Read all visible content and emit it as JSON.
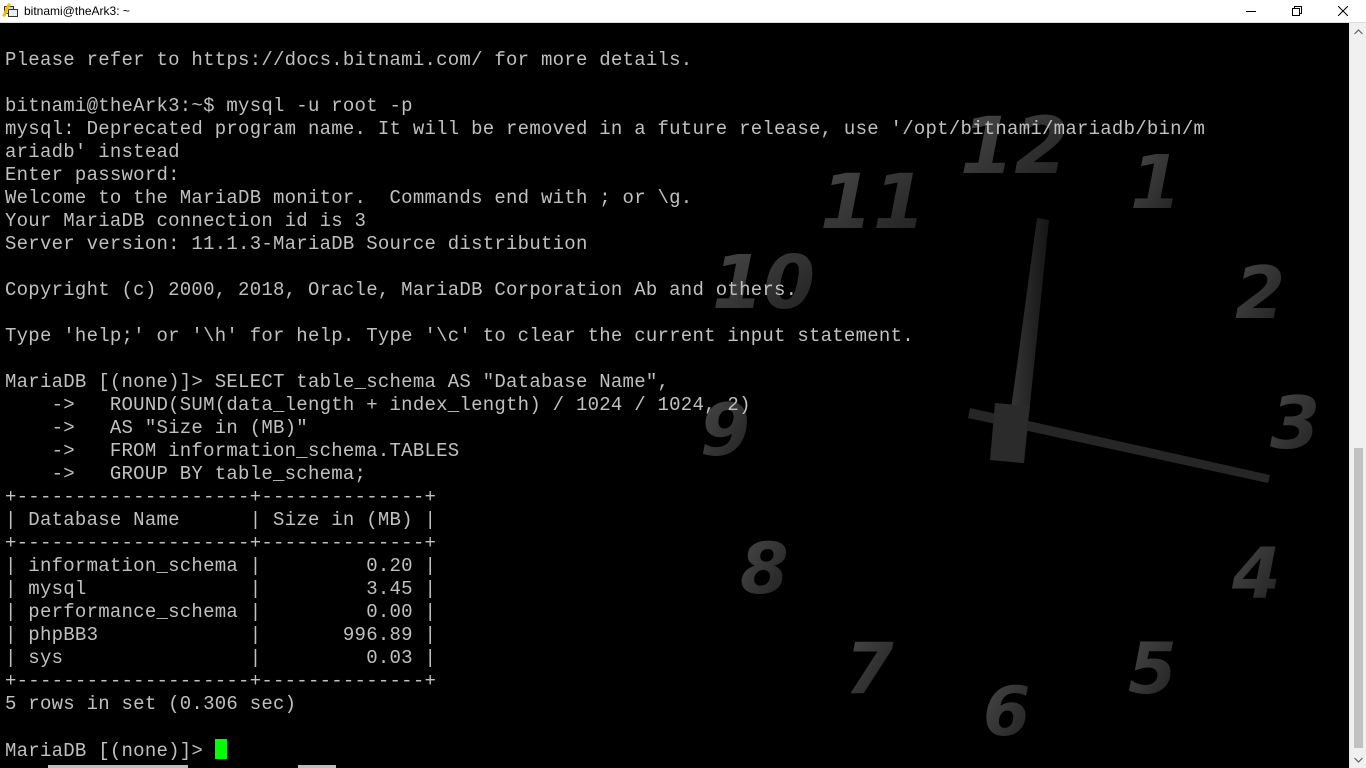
{
  "window": {
    "title": "bitnami@theArk3: ~",
    "app_icon": "putty-icon",
    "minimize_icon": "minimize-icon",
    "restore_icon": "restore-icon",
    "close_icon": "close-icon"
  },
  "terminal": {
    "lines": [
      "Please refer to https://docs.bitnami.com/ for more details.",
      "",
      "bitnami@theArk3:~$ mysql -u root -p",
      "mysql: Deprecated program name. It will be removed in a future release, use '/opt/bitnami/mariadb/bin/m",
      "ariadb' instead",
      "Enter password:",
      "Welcome to the MariaDB monitor.  Commands end with ; or \\g.",
      "Your MariaDB connection id is 3",
      "Server version: 11.1.3-MariaDB Source distribution",
      "",
      "Copyright (c) 2000, 2018, Oracle, MariaDB Corporation Ab and others.",
      "",
      "Type 'help;' or '\\h' for help. Type '\\c' to clear the current input statement.",
      "",
      "MariaDB [(none)]> SELECT table_schema AS \"Database Name\",",
      "    ->   ROUND(SUM(data_length + index_length) / 1024 / 1024, 2)",
      "    ->   AS \"Size in (MB)\"",
      "    ->   FROM information_schema.TABLES",
      "    ->   GROUP BY table_schema;",
      "+--------------------+--------------+",
      "| Database Name      | Size in (MB) |",
      "+--------------------+--------------+",
      "| information_schema |         0.20 |",
      "| mysql              |         3.45 |",
      "| performance_schema |         0.00 |",
      "| phpBB3             |       996.89 |",
      "| sys                |         0.03 |",
      "+--------------------+--------------+",
      "5 rows in set (0.306 sec)",
      ""
    ],
    "prompt": "MariaDB [(none)]> ",
    "cursor_color": "#00ff00",
    "text_color": "#c0c0c0",
    "background_color": "#000000"
  },
  "wallpaper": {
    "clock_numerals": [
      "12",
      "1",
      "2",
      "3",
      "4",
      "5",
      "6",
      "7",
      "8",
      "9",
      "10",
      "11"
    ]
  }
}
